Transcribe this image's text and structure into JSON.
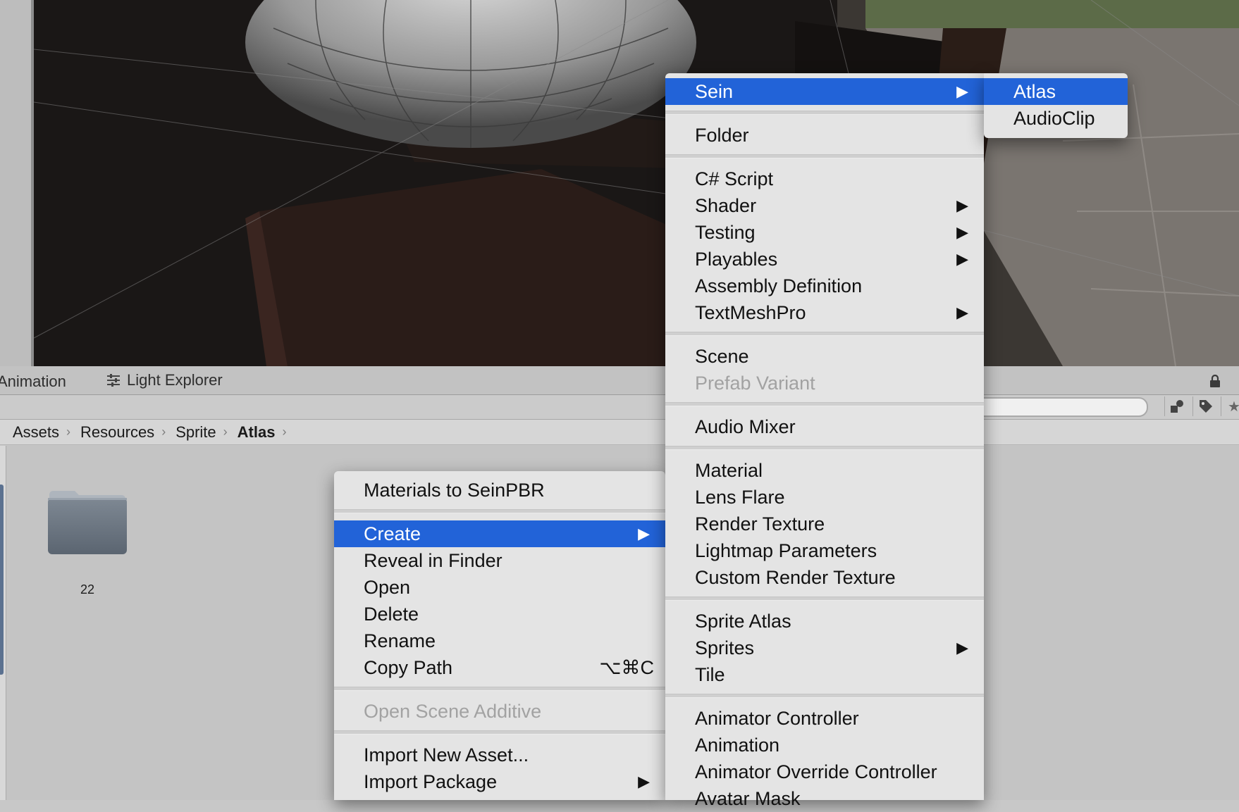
{
  "tabs": [
    {
      "label": "Animation"
    },
    {
      "label": "Light Explorer"
    }
  ],
  "breadcrumb": [
    "Assets",
    "Resources",
    "Sprite",
    "Atlas"
  ],
  "assets": [
    {
      "name": "22"
    }
  ],
  "context_menu": {
    "items": [
      {
        "label": "Materials to SeinPBR"
      },
      {
        "label": "Create",
        "highlighted": true,
        "submenu": true
      },
      {
        "label": "Reveal in Finder"
      },
      {
        "label": "Open"
      },
      {
        "label": "Delete"
      },
      {
        "label": "Rename"
      },
      {
        "label": "Copy Path",
        "shortcut": "⌥⌘C"
      },
      {
        "label": "Open Scene Additive",
        "disabled": true
      },
      {
        "label": "Import New Asset..."
      },
      {
        "label": "Import Package",
        "submenu": true
      }
    ]
  },
  "create_menu": {
    "items": [
      {
        "label": "Sein",
        "highlighted": true,
        "submenu": true
      },
      {
        "label": "Folder"
      },
      {
        "label": "C# Script"
      },
      {
        "label": "Shader",
        "submenu": true
      },
      {
        "label": "Testing",
        "submenu": true
      },
      {
        "label": "Playables",
        "submenu": true
      },
      {
        "label": "Assembly Definition"
      },
      {
        "label": "TextMeshPro",
        "submenu": true
      },
      {
        "label": "Scene"
      },
      {
        "label": "Prefab Variant",
        "disabled": true
      },
      {
        "label": "Audio Mixer"
      },
      {
        "label": "Material"
      },
      {
        "label": "Lens Flare"
      },
      {
        "label": "Render Texture"
      },
      {
        "label": "Lightmap Parameters"
      },
      {
        "label": "Custom Render Texture"
      },
      {
        "label": "Sprite Atlas"
      },
      {
        "label": "Sprites",
        "submenu": true
      },
      {
        "label": "Tile"
      },
      {
        "label": "Animator Controller"
      },
      {
        "label": "Animation"
      },
      {
        "label": "Animator Override Controller"
      },
      {
        "label": "Avatar Mask"
      }
    ]
  },
  "sein_menu": {
    "items": [
      {
        "label": "Atlas",
        "highlighted": true
      },
      {
        "label": "AudioClip"
      }
    ]
  },
  "glyphs": {
    "submenu_arrow": "▶",
    "crumb_separator": "›"
  },
  "colors": {
    "highlight": "#2263d8",
    "menu_bg": "#e4e4e4",
    "disabled": "#a2a2a2"
  }
}
